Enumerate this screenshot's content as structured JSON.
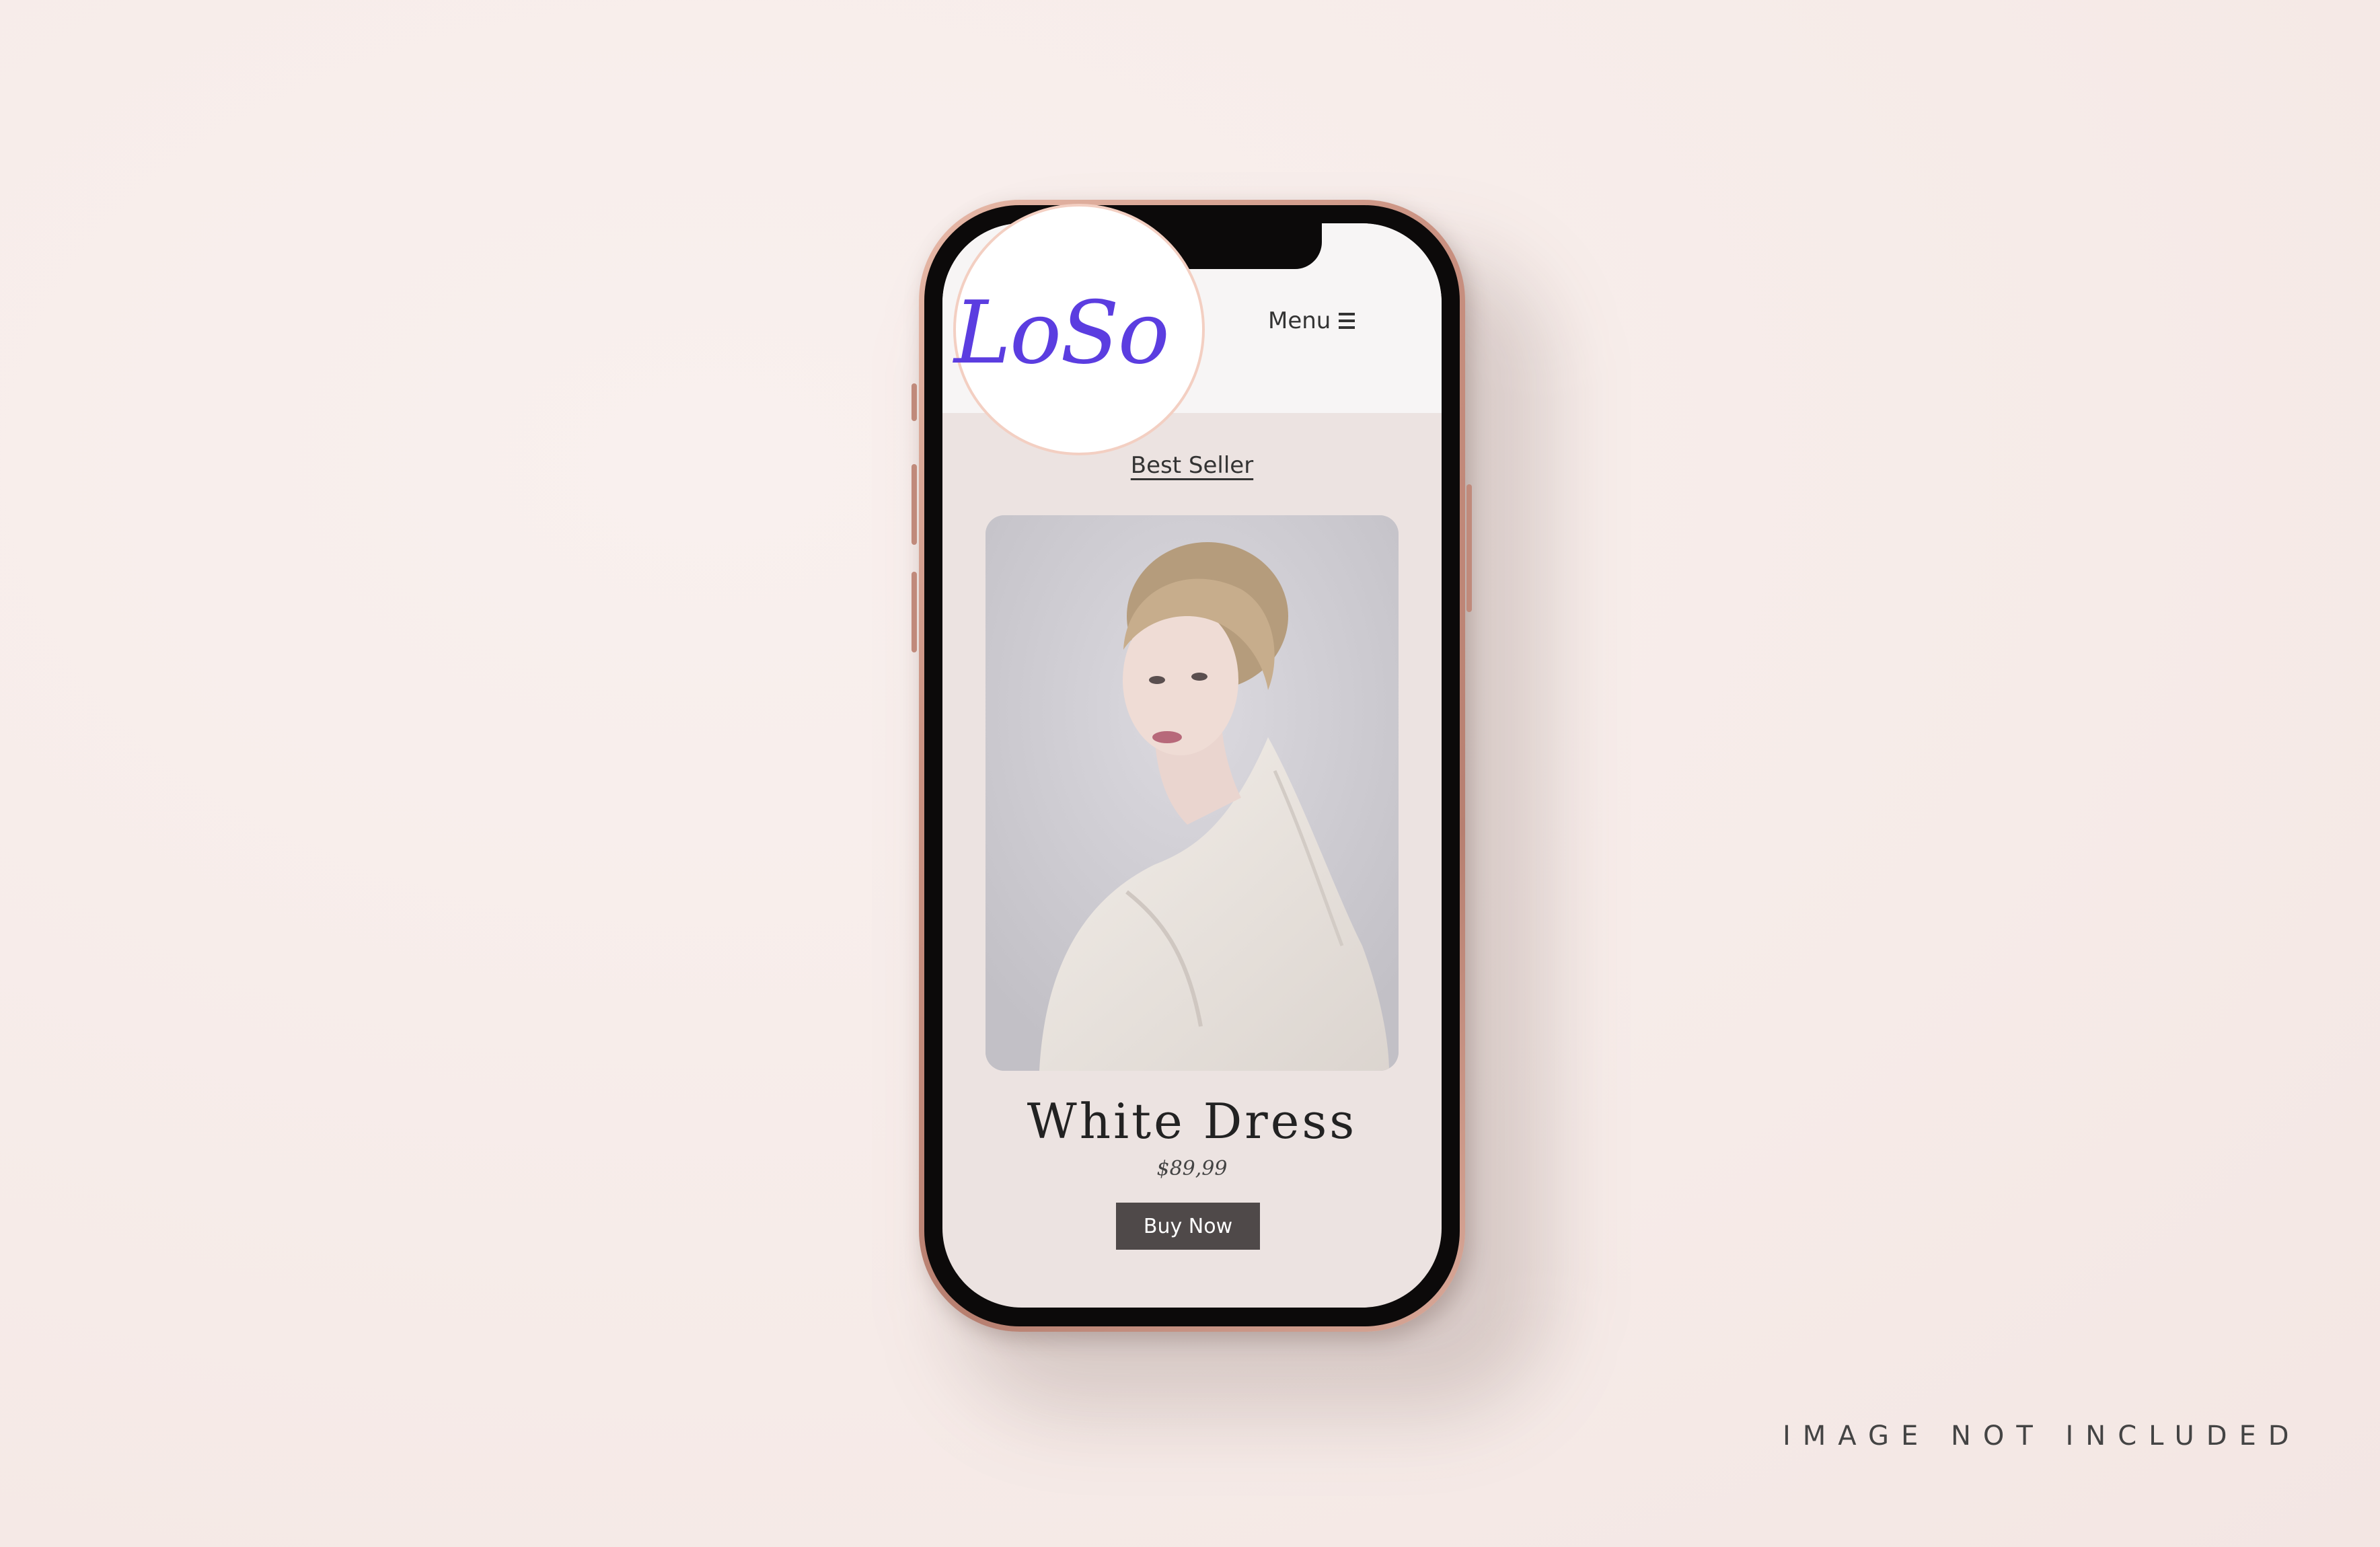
{
  "header": {
    "logo": "LoSo",
    "menu_label": "Menu"
  },
  "section": {
    "heading": "Best Seller"
  },
  "product": {
    "name": "White Dress",
    "price": "$89,99",
    "cta": "Buy Now"
  },
  "footer_note": "IMAGE NOT INCLUDED",
  "colors": {
    "logo": "#5b3de0",
    "button_bg": "#4f4949",
    "phone_frame": "#c88f7f",
    "background": "#f7eeeb"
  }
}
